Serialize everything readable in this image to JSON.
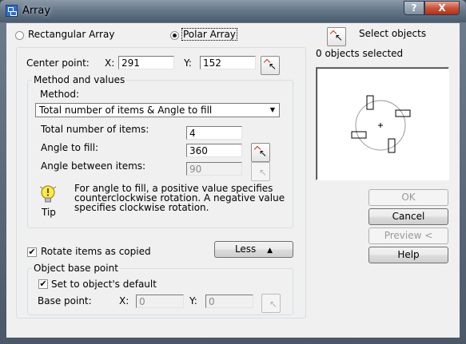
{
  "window": {
    "title": "Array",
    "help_button": "?",
    "close_button": "X"
  },
  "array_type": {
    "rectangular_label": "Rectangular Array",
    "polar_label": "Polar Array",
    "selected": "Polar Array"
  },
  "select_objects": {
    "label": "Select objects",
    "status": "0 objects selected"
  },
  "center_point": {
    "label": "Center point:",
    "x_label": "X:",
    "x_value": "291",
    "y_label": "Y:",
    "y_value": "152"
  },
  "method_group": {
    "title": "Method and values",
    "method_label": "Method:",
    "method_value": "Total number of items & Angle to fill",
    "total_items_label": "Total number of items:",
    "total_items_value": "4",
    "angle_fill_label": "Angle to fill:",
    "angle_fill_value": "360",
    "angle_between_label": "Angle between items:",
    "angle_between_value": "90",
    "tip_label": "Tip",
    "tip_text": "For angle to fill, a positive value specifies counterclockwise rotation.  A negative value specifies clockwise rotation."
  },
  "rotate_items": {
    "label": "Rotate items as copied",
    "checked": true
  },
  "less_button": {
    "label": "Less",
    "icon": "double-chevron-up-icon"
  },
  "object_base_point": {
    "title": "Object base point",
    "default_label": "Set to object's default",
    "default_checked": true,
    "base_point_label": "Base point:",
    "x_label": "X:",
    "x_value": "0",
    "y_label": "Y:",
    "y_value": "0"
  },
  "buttons": {
    "ok": "OK",
    "cancel": "Cancel",
    "preview": "Preview <",
    "help": "Help"
  },
  "colors": {
    "accent_red": "#c8321e",
    "disabled_text": "#9a9a9a",
    "dialog_bg": "#f0f0f0"
  }
}
